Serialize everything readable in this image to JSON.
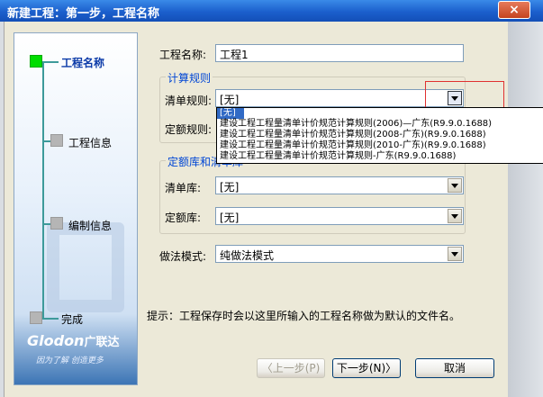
{
  "window": {
    "title": "新建工程：第一步，工程名称",
    "close_symbol": "×"
  },
  "sidebar": {
    "steps": [
      {
        "label": "工程名称",
        "active": true
      },
      {
        "label": "工程信息",
        "active": false
      },
      {
        "label": "编制信息",
        "active": false
      },
      {
        "label": "完成",
        "active": false
      }
    ],
    "logo_en": "Glodon",
    "logo_cn": "广联达",
    "slogan": "因为了解 创造更多"
  },
  "form": {
    "project_name_label": "工程名称:",
    "project_name_value": "工程1",
    "calc_rules_group": "计算规则",
    "list_rule_label": "清单规则:",
    "list_rule_value": "[无]",
    "quota_rule_label": "定额规则:",
    "library_group": "定额库和清单库",
    "list_lib_label": "清单库:",
    "list_lib_value": "[无]",
    "quota_lib_label": "定额库:",
    "quota_lib_value": "[无]",
    "mode_label": "做法模式:",
    "mode_value": "纯做法模式",
    "hint": "提示：工程保存时会以这里所输入的工程名称做为默认的文件名。"
  },
  "dropdown": {
    "options": [
      "[无]",
      "建设工程工程量清单计价规范计算规则(2006)—广东(R9.9.0.1688)",
      "建设工程工程量清单计价规范计算规则(2008-广东)(R9.9.0.1688)",
      "建设工程工程量清单计价规范计算规则(2010-广东)(R9.9.0.1688)",
      "建设工程工程量清单计价规范计算规则-广东(R9.9.0.1688)"
    ],
    "selected_index": 0
  },
  "buttons": {
    "prev": "〈上一步(P)",
    "next": "下一步(N)〉",
    "cancel": "取消"
  },
  "colors": {
    "title_bar": "#1b5fcc",
    "active_step": "#00dd00",
    "group_title": "#0046d5",
    "highlight_box": "#e03030",
    "selection": "#316ac5"
  }
}
